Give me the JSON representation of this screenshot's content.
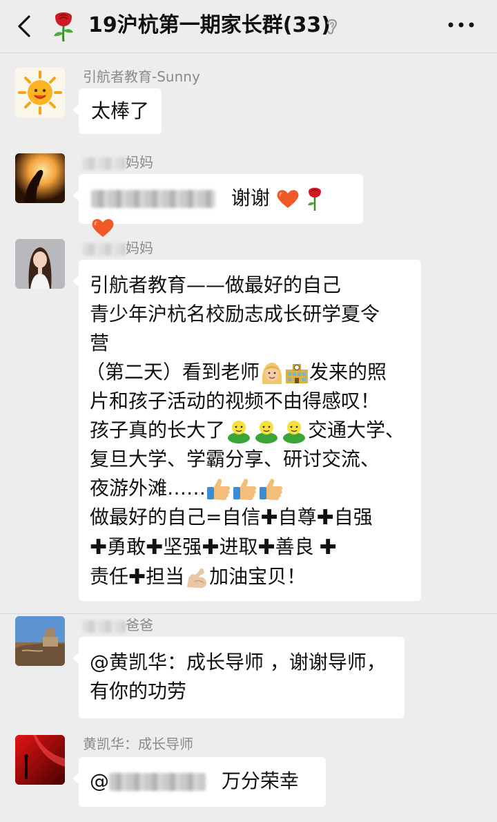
{
  "header": {
    "title": "19沪杭第一期家长群(33)"
  },
  "messages": [
    {
      "sender": "引航者教育-Sunny",
      "text": "太棒了"
    },
    {
      "sender_suffix": "妈妈",
      "text": "谢谢"
    },
    {
      "sender_suffix": "妈妈",
      "lines": [
        "引航者教育——做最好的自己",
        "青少年沪杭名校励志成长研学夏令",
        "营",
        "（第二天）看到老师",
        "发来的照",
        "片和孩子活动的视频不由得感叹！",
        "孩子真的长大了",
        "交通大学、",
        "复旦大学、学霸分享、研讨交流、",
        "夜游外滩……",
        "做最好的自己=自信",
        "自尊",
        "自强",
        "勇敢",
        "坚强",
        "进取",
        "善良",
        "责任",
        "担当",
        "加油宝贝！"
      ]
    },
    {
      "sender_suffix": "爸爸",
      "lines": [
        "@黄凯华：成长导师 ，谢谢导师，",
        "有你的功劳"
      ]
    },
    {
      "sender": "黄凯华：成长导师",
      "prefix": "@",
      "text": "万分荣幸"
    }
  ]
}
